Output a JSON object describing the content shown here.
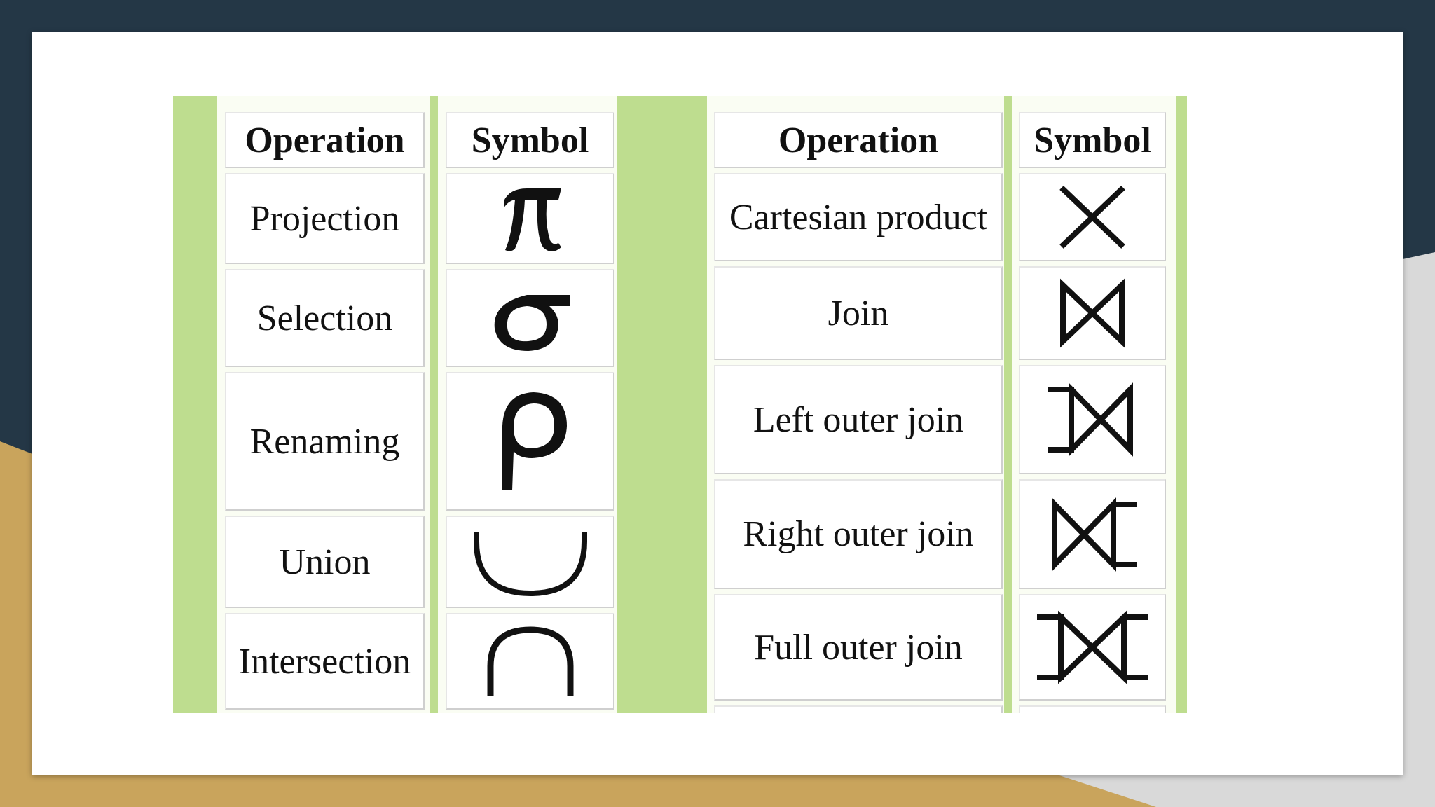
{
  "tables": [
    {
      "headers": {
        "operation": "Operation",
        "symbol": "Symbol"
      },
      "rows": [
        {
          "operation": "Projection",
          "symbol": "π",
          "icon": "pi-icon"
        },
        {
          "operation": "Selection",
          "symbol": "σ",
          "icon": "sigma-icon"
        },
        {
          "operation": "Renaming",
          "symbol": "ρ",
          "icon": "rho-icon"
        },
        {
          "operation": "Union",
          "symbol": "∪",
          "icon": "union-icon"
        },
        {
          "operation": "Intersection",
          "symbol": "∩",
          "icon": "intersection-icon"
        }
      ]
    },
    {
      "headers": {
        "operation": "Operation",
        "symbol": "Symbol"
      },
      "rows": [
        {
          "operation": "Cartesian product",
          "symbol": "×",
          "icon": "times-icon"
        },
        {
          "operation": "Join",
          "symbol": "⋈",
          "icon": "bowtie-icon"
        },
        {
          "operation": "Left outer join",
          "symbol": "⟕",
          "icon": "left-outer-join-icon"
        },
        {
          "operation": "Right outer join",
          "symbol": "⟖",
          "icon": "right-outer-join-icon"
        },
        {
          "operation": "Full outer join",
          "symbol": "⟗",
          "icon": "full-outer-join-icon"
        }
      ]
    }
  ],
  "colors": {
    "background_dark": "#243746",
    "background_gold": "#c9a45c",
    "figure_green": "#bedd8f",
    "slide": "#ffffff"
  }
}
